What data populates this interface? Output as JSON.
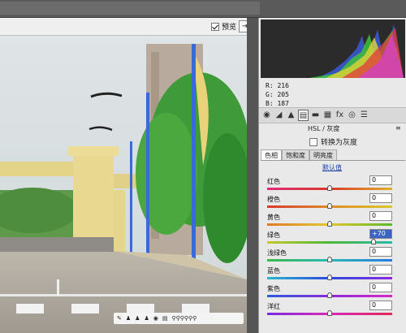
{
  "toolbar": {
    "preview_label": "预览",
    "preview_checked": true
  },
  "histogram": {
    "r_label": "R:",
    "r_value": "216",
    "g_label": "G:",
    "g_value": "205",
    "b_label": "B:",
    "b_value": "187"
  },
  "panel": {
    "tool_icons": [
      "histogram-basic-icon",
      "tone-curve-icon",
      "detail-icon",
      "hsl-icon",
      "split-toning-icon",
      "lens-icon",
      "effects-icon",
      "camera-calibration-icon",
      "presets-icon"
    ],
    "active_tool_index": 3,
    "section_title": "HSL / 灰度",
    "section_menu": "≡",
    "convert_gray_label": "转换为灰度",
    "convert_gray_checked": false,
    "tabs": [
      "色相",
      "饱和度",
      "明亮度"
    ],
    "active_tab_index": 0,
    "default_label": "默认值",
    "sliders": [
      {
        "label": "红色",
        "value": "0",
        "position": 0.5,
        "colors": [
          "#e02a7a",
          "#d63a2a",
          "#e0b02a"
        ]
      },
      {
        "label": "橙色",
        "value": "0",
        "position": 0.5,
        "colors": [
          "#d43a2a",
          "#e08a2a",
          "#d8c82a"
        ]
      },
      {
        "label": "黄色",
        "value": "0",
        "position": 0.5,
        "colors": [
          "#e07a2a",
          "#e0c82a",
          "#5ab82a"
        ]
      },
      {
        "label": "绿色",
        "value": "+70",
        "position": 0.85,
        "colors": [
          "#c8c82a",
          "#4ab83a",
          "#2ab8a8"
        ],
        "selected": true
      },
      {
        "label": "浅绿色",
        "value": "0",
        "position": 0.5,
        "colors": [
          "#3ab84a",
          "#2ab8b8",
          "#2a7ae0"
        ]
      },
      {
        "label": "蓝色",
        "value": "0",
        "position": 0.5,
        "colors": [
          "#2ab8c8",
          "#2a4ae0",
          "#8a2ae0"
        ]
      },
      {
        "label": "紫色",
        "value": "0",
        "position": 0.5,
        "colors": [
          "#2a5ae0",
          "#8a2ad8",
          "#d82ac8"
        ]
      },
      {
        "label": "洋红",
        "value": "0",
        "position": 0.5,
        "colors": [
          "#7a2ae0",
          "#d82ab8",
          "#e02a5a"
        ]
      }
    ]
  },
  "photo_tools": [
    "✎",
    "♟",
    "♟",
    "♟",
    "◉",
    "▤",
    "⚲⚲⚲⚲⚲⚲"
  ]
}
